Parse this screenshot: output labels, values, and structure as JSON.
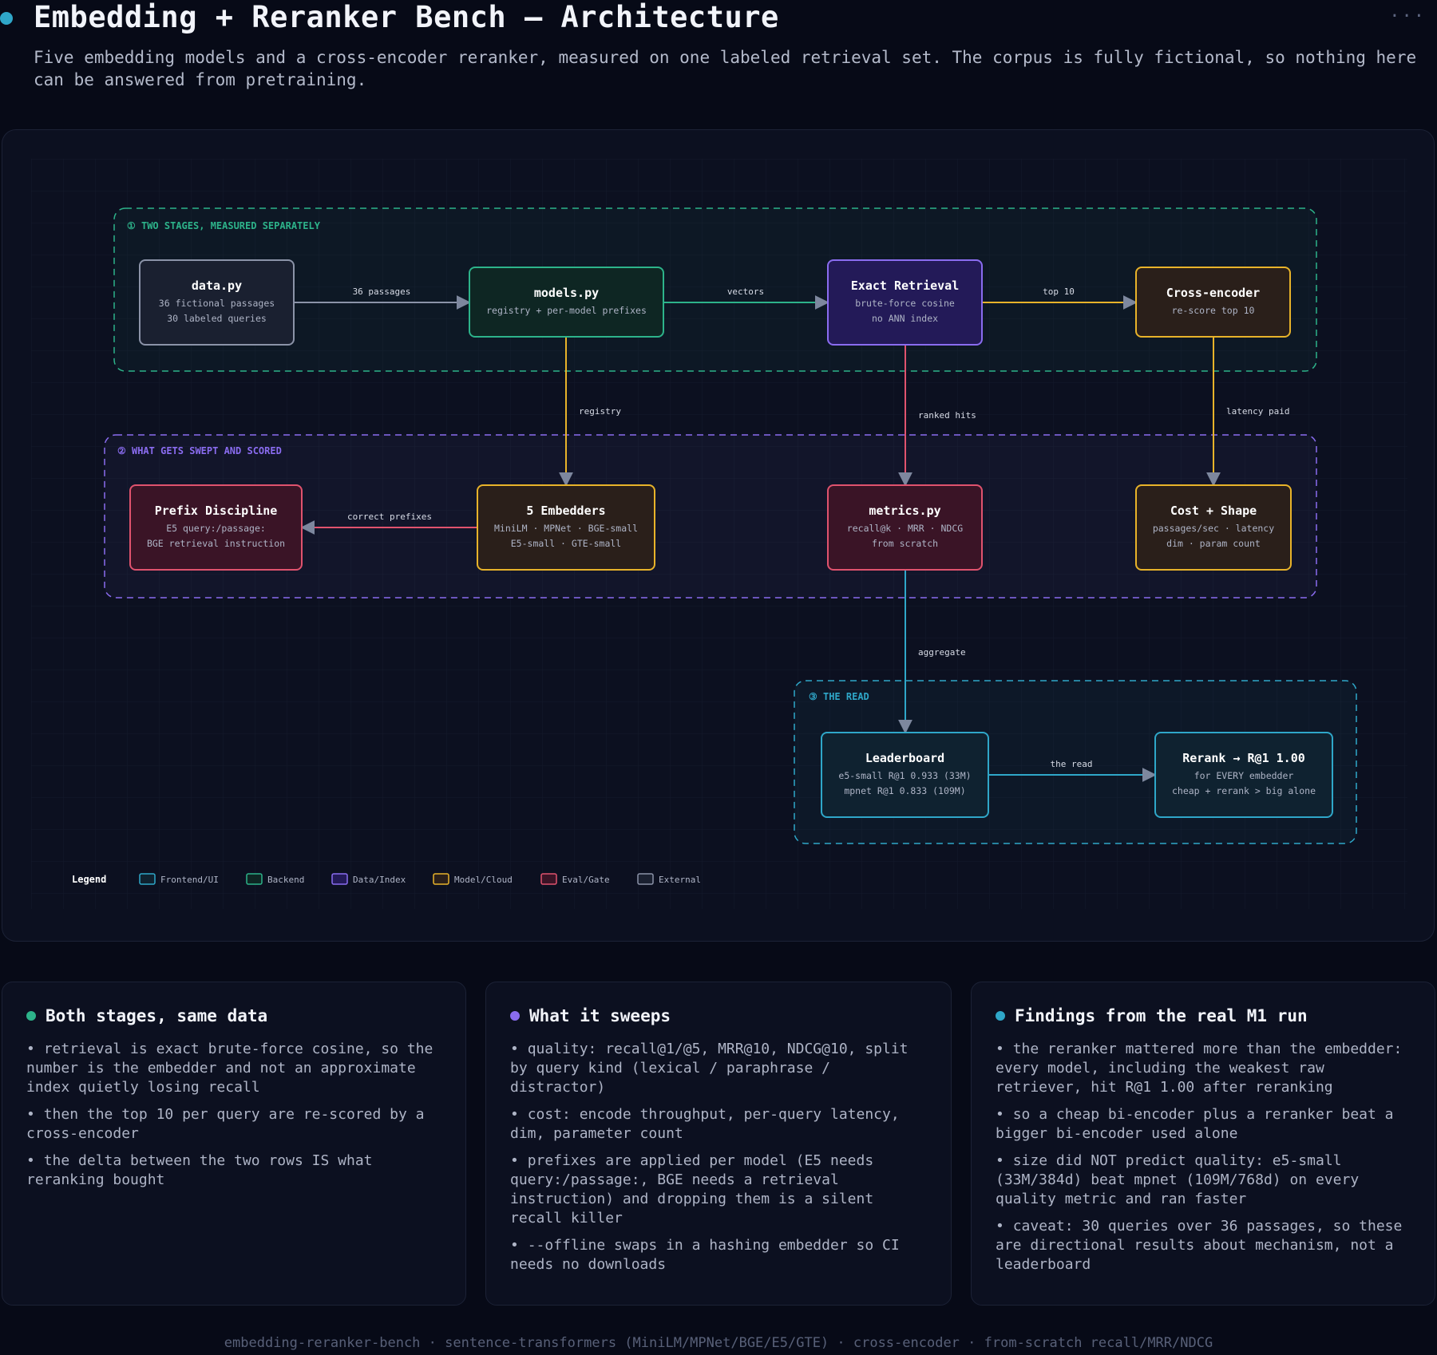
{
  "header": {
    "title": "Embedding + Reranker Bench — Architecture",
    "subtitle": "Five embedding models and a cross-encoder reranker, measured on one labeled retrieval set. The corpus is fully fictional, so nothing here can be answered from pretraining.",
    "more_icon": "more-horizontal-icon"
  },
  "colors": {
    "frontend": "#2fa7c9",
    "backend": "#2db38a",
    "data": "#8a6cf0",
    "model": "#e8b32a",
    "eval": "#e0536e",
    "external": "#8b93a8"
  },
  "groups": [
    {
      "id": "g1",
      "label": "① TWO STAGES, MEASURED SEPARATELY",
      "color": "#2db38a"
    },
    {
      "id": "g2",
      "label": "② WHAT GETS SWEPT AND SCORED",
      "color": "#8a6cf0"
    },
    {
      "id": "g3",
      "label": "③ THE READ",
      "color": "#2fa7c9"
    }
  ],
  "nodes": [
    {
      "id": "data",
      "title": "data.py",
      "lines": [
        "36 fictional passages",
        "30 labeled queries"
      ],
      "kind": "external"
    },
    {
      "id": "models",
      "title": "models.py",
      "lines": [
        "registry + per-model prefixes"
      ],
      "kind": "backend"
    },
    {
      "id": "retrieval",
      "title": "Exact Retrieval",
      "lines": [
        "brute-force cosine",
        "no ANN index"
      ],
      "kind": "data"
    },
    {
      "id": "crossenc",
      "title": "Cross-encoder",
      "lines": [
        "re-score top 10"
      ],
      "kind": "model"
    },
    {
      "id": "prefix",
      "title": "Prefix Discipline",
      "lines": [
        "E5 query:/passage:",
        "BGE retrieval instruction"
      ],
      "kind": "eval"
    },
    {
      "id": "embedders",
      "title": "5 Embedders",
      "lines": [
        "MiniLM · MPNet · BGE-small",
        "E5-small · GTE-small"
      ],
      "kind": "model"
    },
    {
      "id": "metrics",
      "title": "metrics.py",
      "lines": [
        "recall@k · MRR · NDCG",
        "from scratch"
      ],
      "kind": "eval"
    },
    {
      "id": "cost",
      "title": "Cost + Shape",
      "lines": [
        "passages/sec · latency",
        "dim · param count"
      ],
      "kind": "model"
    },
    {
      "id": "leaderboard",
      "title": "Leaderboard",
      "lines": [
        "e5-small R@1 0.933 (33M)",
        "mpnet R@1 0.833 (109M)"
      ],
      "kind": "frontend"
    },
    {
      "id": "rerank",
      "title": "Rerank → R@1 1.00",
      "lines": [
        "for EVERY embedder",
        "cheap + rerank > big alone"
      ],
      "kind": "frontend"
    }
  ],
  "edges": [
    {
      "from": "data",
      "to": "models",
      "label": "36 passages",
      "kind": "external"
    },
    {
      "from": "models",
      "to": "retrieval",
      "label": "vectors",
      "kind": "backend"
    },
    {
      "from": "retrieval",
      "to": "crossenc",
      "label": "top 10",
      "kind": "model"
    },
    {
      "from": "models",
      "to": "embedders",
      "label": "registry",
      "kind": "model"
    },
    {
      "from": "retrieval",
      "to": "metrics",
      "label": "ranked hits",
      "kind": "eval"
    },
    {
      "from": "crossenc",
      "to": "cost",
      "label": "latency paid",
      "kind": "model"
    },
    {
      "from": "embedders",
      "to": "prefix",
      "label": "correct prefixes",
      "kind": "eval"
    },
    {
      "from": "metrics",
      "to": "leaderboard",
      "label": "aggregate",
      "kind": "frontend"
    },
    {
      "from": "leaderboard",
      "to": "rerank",
      "label": "the read",
      "kind": "frontend"
    }
  ],
  "legend": {
    "title": "Legend",
    "items": [
      {
        "label": "Frontend/UI",
        "kind": "frontend"
      },
      {
        "label": "Backend",
        "kind": "backend"
      },
      {
        "label": "Data/Index",
        "kind": "data"
      },
      {
        "label": "Model/Cloud",
        "kind": "model"
      },
      {
        "label": "Eval/Gate",
        "kind": "eval"
      },
      {
        "label": "External",
        "kind": "external"
      }
    ]
  },
  "cards": [
    {
      "title": "Both stages, same data",
      "dot_color": "#2db38a",
      "bullets": [
        "retrieval is exact brute-force cosine, so the number is the embedder and not an approximate index quietly losing recall",
        "then the top 10 per query are re-scored by a cross-encoder",
        "the delta between the two rows IS what reranking bought"
      ]
    },
    {
      "title": "What it sweeps",
      "dot_color": "#8a6cf0",
      "bullets": [
        "quality: recall@1/@5, MRR@10, NDCG@10, split by query kind (lexical / paraphrase / distractor)",
        "cost: encode throughput, per-query latency, dim, parameter count",
        "prefixes are applied per model (E5 needs query:/passage:, BGE needs a retrieval instruction) and dropping them is a silent recall killer",
        "--offline swaps in a hashing embedder so CI needs no downloads"
      ]
    },
    {
      "title": "Findings from the real M1 run",
      "dot_color": "#2fa7c9",
      "bullets": [
        "the reranker mattered more than the embedder: every model, including the weakest raw retriever, hit R@1 1.00 after reranking",
        "so a cheap bi-encoder plus a reranker beat a bigger bi-encoder used alone",
        "size did NOT predict quality: e5-small (33M/384d) beat mpnet (109M/768d) on every quality metric and ran faster",
        "caveat: 30 queries over 36 passages, so these are directional results about mechanism, not a leaderboard"
      ]
    }
  ],
  "footer": "embedding-reranker-bench · sentence-transformers (MiniLM/MPNet/BGE/E5/GTE) · cross-encoder · from-scratch recall/MRR/NDCG"
}
